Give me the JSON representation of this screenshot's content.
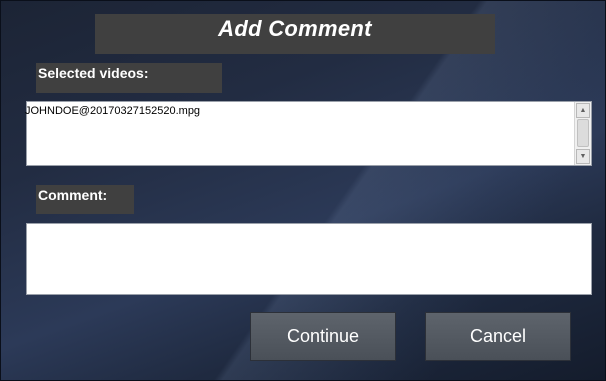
{
  "dialog": {
    "title": "Add Comment"
  },
  "selected_videos": {
    "label": "Selected videos:",
    "items": [
      "JOHNDOE@20170327152520.mpg"
    ]
  },
  "comment": {
    "label": "Comment:",
    "value": "",
    "placeholder": ""
  },
  "buttons": {
    "continue_label": "Continue",
    "cancel_label": "Cancel"
  },
  "icons": {
    "scroll_up": "scroll-up-arrow-icon",
    "scroll_down": "scroll-down-arrow-icon"
  },
  "colors": {
    "background_dark": "#1c2435",
    "label_box": "#404040",
    "button": "#555b63",
    "text": "#ffffff"
  }
}
